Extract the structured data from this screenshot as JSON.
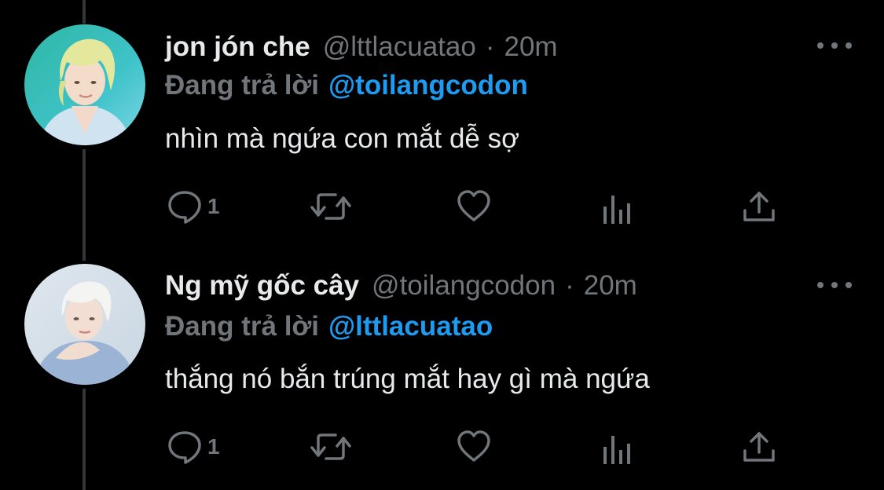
{
  "tweets": [
    {
      "name": "jon jón che",
      "handle": "@lttlacuatao",
      "dot": "·",
      "time": "20m",
      "reply_prefix": "Đang trả lời",
      "reply_to": "@toilangcodon",
      "text": "nhìn mà ngứa con mắt dễ sợ",
      "actions": {
        "reply_count": "1"
      }
    },
    {
      "name": "Ng mỹ gốc cây",
      "handle": "@toilangcodon",
      "dot": "·",
      "time": "20m",
      "reply_prefix": "Đang trả lời",
      "reply_to": "@lttlacuatao",
      "text": "thắng nó bắn trúng mắt hay gì mà ngứa",
      "actions": {
        "reply_count": "1"
      }
    }
  ],
  "icons": {
    "reply": "speech-bubble-icon",
    "retweet": "retweet-arrows-icon",
    "like": "heart-icon",
    "views": "bar-chart-icon",
    "share": "upload-arrow-icon",
    "more": "ellipsis-icon"
  },
  "colors": {
    "background": "#000000",
    "text": "#e7e9ea",
    "muted": "#71767b",
    "accent": "#1d9bf0",
    "thread_line": "#333639"
  }
}
